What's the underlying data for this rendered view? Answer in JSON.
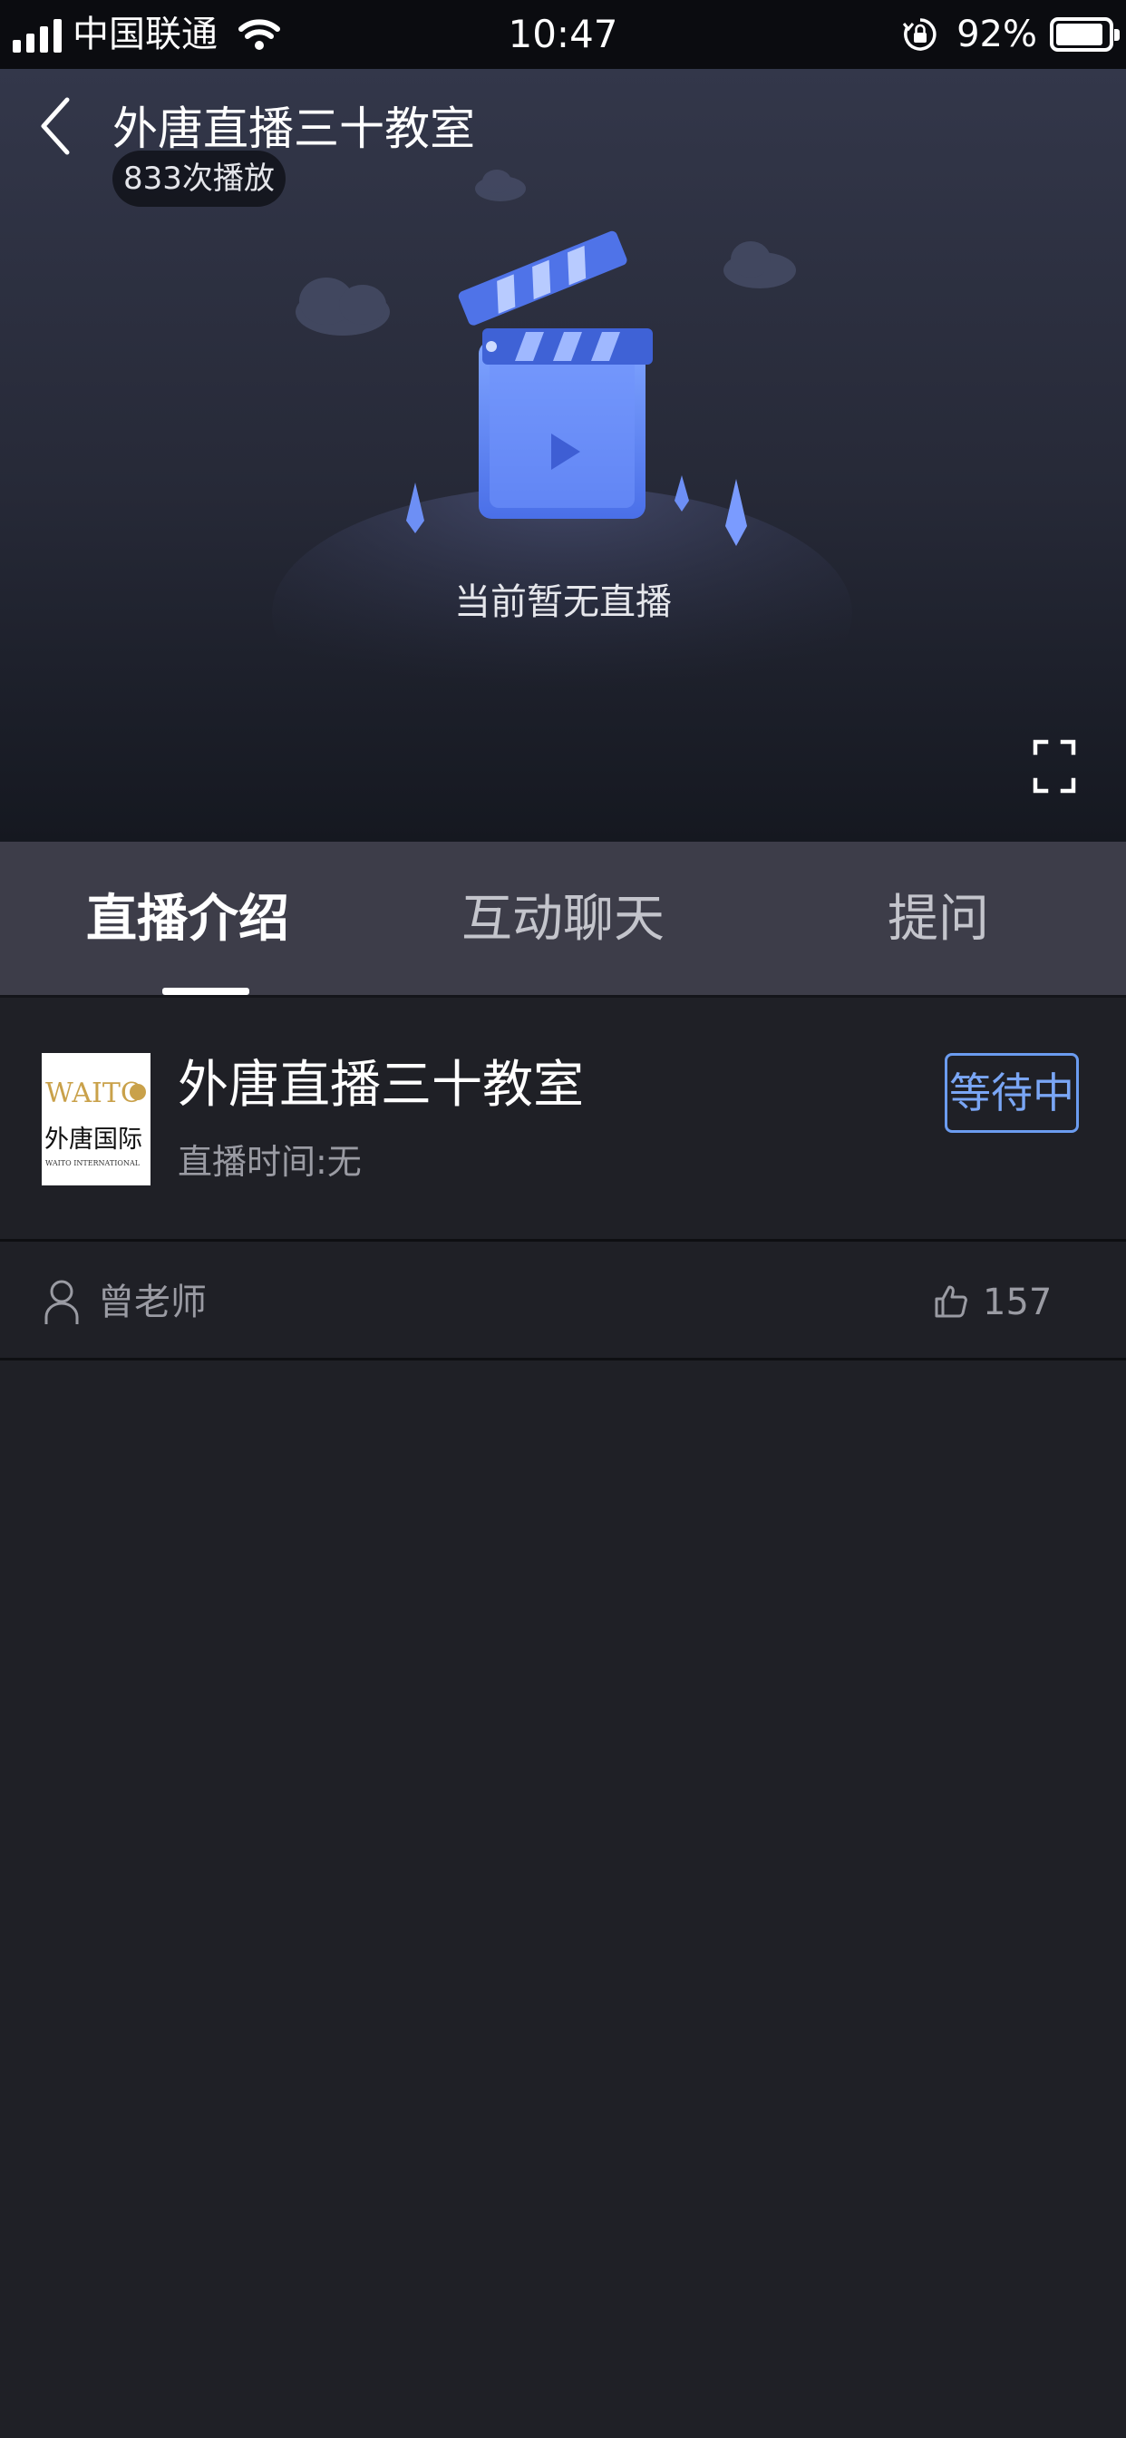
{
  "status_bar": {
    "carrier": "中国联通",
    "time": "10:47",
    "battery_percent_label": "92%",
    "battery_level": 0.92,
    "icons": [
      "signal-icon",
      "wifi-icon",
      "rotation-lock-icon",
      "battery-icon"
    ]
  },
  "player": {
    "title": "外唐直播三十教室",
    "play_count": "833次播放",
    "empty_message": "当前暂无直播",
    "icons": [
      "back-icon",
      "clapperboard-icon",
      "fullscreen-icon"
    ]
  },
  "tabs": [
    {
      "label": "直播介绍",
      "active": true
    },
    {
      "label": "互动聊天",
      "active": false
    },
    {
      "label": "提问",
      "active": false
    }
  ],
  "live_info": {
    "logo": {
      "brand": "WAITO",
      "chinese": "外唐国际",
      "english": "WAITO INTERNATIONAL"
    },
    "title": "外唐直播三十教室",
    "time": "直播时间:无",
    "status": "等待中"
  },
  "teacher": {
    "name": "曾老师",
    "likes": "157",
    "icons": [
      "person-icon",
      "thumbs-up-icon"
    ]
  },
  "colors": {
    "accent": "#6b9cf0",
    "tab_bar": "#3d3d49",
    "background": "#1f2026",
    "logo_gold": "#c9a14a"
  }
}
